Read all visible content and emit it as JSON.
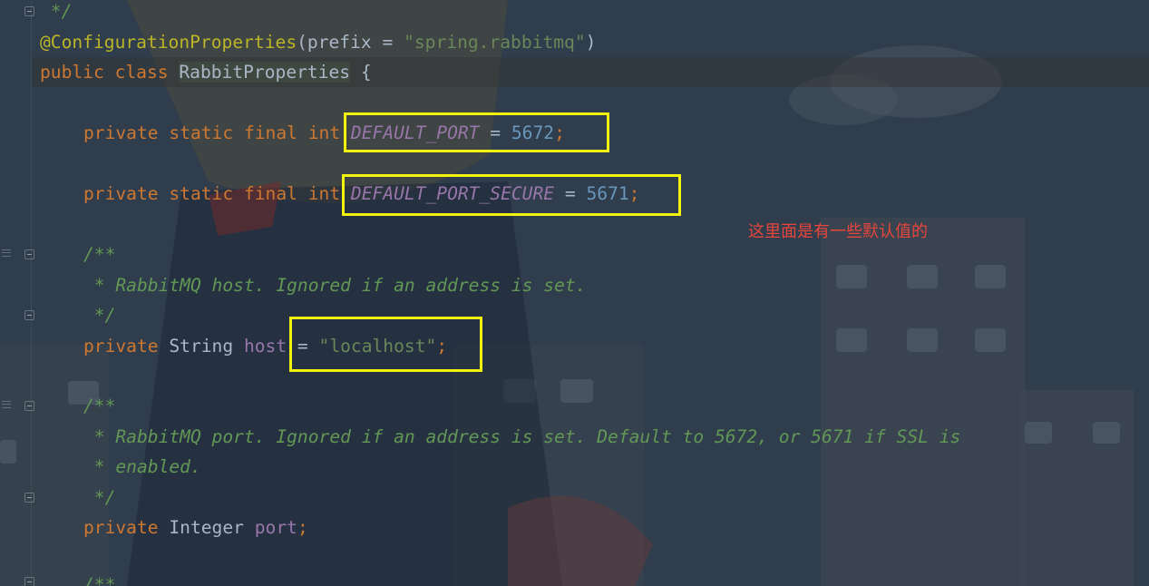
{
  "code_lines": {
    "l0": {
      "comment_end": " */"
    },
    "l1": {
      "annotation": "@ConfigurationProperties",
      "open": "(prefix = ",
      "value": "\"spring.rabbitmq\"",
      "close": ")"
    },
    "l2": {
      "kw": "public class ",
      "class_name": "RabbitProperties",
      "rest": " {"
    },
    "l3": {
      "kw": "private static final int",
      "name": "DEFAULT_PORT",
      "eq": " = ",
      "value": "5672",
      "semi": ";"
    },
    "l4": {
      "kw": "private static final int",
      "name": "DEFAULT_PORT_SECURE",
      "eq": " = ",
      "value": "5671",
      "semi": ";"
    },
    "l5": {
      "doc": "/**"
    },
    "l6": {
      "doc": " * RabbitMQ host. Ignored if an address is set."
    },
    "l7": {
      "doc": " */"
    },
    "l8": {
      "kw": "private ",
      "type": "String ",
      "name": "host",
      "eq": " = ",
      "value": "\"localhost\"",
      "semi": ";"
    },
    "l9": {
      "doc": "/**"
    },
    "l10": {
      "doc": " * RabbitMQ port. Ignored if an address is set. Default to 5672, or 5671 if SSL is"
    },
    "l11": {
      "doc": " * enabled."
    },
    "l12": {
      "doc": " */"
    },
    "l13": {
      "kw": "private ",
      "type": "Integer ",
      "name": "port",
      "semi": ";"
    },
    "l14": {
      "doc": "/**"
    }
  },
  "annotation_note": "这里面是有一些默认值的",
  "colors": {
    "keyword": "#cc7832",
    "string": "#6a8759",
    "number": "#6897bb",
    "field": "#9876aa",
    "doc_comment": "#629755",
    "highlight_box": "#f2f20c",
    "note": "#e8453c"
  }
}
